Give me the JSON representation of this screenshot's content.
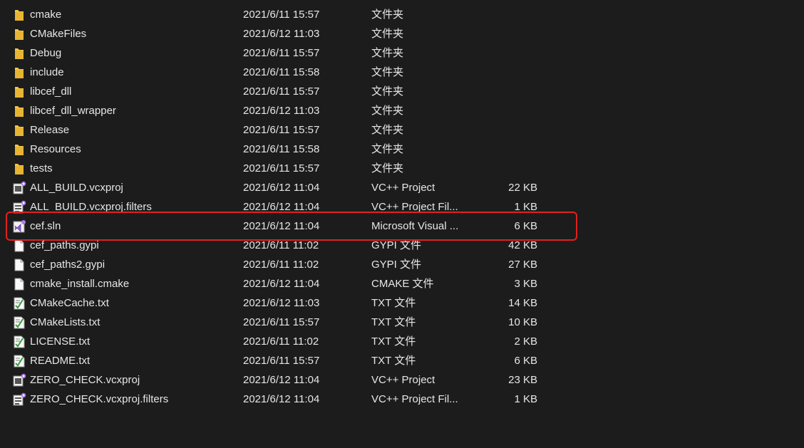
{
  "colors": {
    "background": "#1c1c1c",
    "text": "#e6e6e6",
    "folder": "#f2c545",
    "highlight_border": "#e0221e"
  },
  "files": [
    {
      "name": "cmake",
      "modified": "2021/6/11 15:57",
      "type": "文件夹",
      "size": "",
      "icon": "folder-icon"
    },
    {
      "name": "CMakeFiles",
      "modified": "2021/6/12 11:03",
      "type": "文件夹",
      "size": "",
      "icon": "folder-icon"
    },
    {
      "name": "Debug",
      "modified": "2021/6/11 15:57",
      "type": "文件夹",
      "size": "",
      "icon": "folder-icon"
    },
    {
      "name": "include",
      "modified": "2021/6/11 15:58",
      "type": "文件夹",
      "size": "",
      "icon": "folder-icon"
    },
    {
      "name": "libcef_dll",
      "modified": "2021/6/11 15:57",
      "type": "文件夹",
      "size": "",
      "icon": "folder-icon"
    },
    {
      "name": "libcef_dll_wrapper",
      "modified": "2021/6/12 11:03",
      "type": "文件夹",
      "size": "",
      "icon": "folder-icon"
    },
    {
      "name": "Release",
      "modified": "2021/6/11 15:57",
      "type": "文件夹",
      "size": "",
      "icon": "folder-icon"
    },
    {
      "name": "Resources",
      "modified": "2021/6/11 15:58",
      "type": "文件夹",
      "size": "",
      "icon": "folder-icon"
    },
    {
      "name": "tests",
      "modified": "2021/6/11 15:57",
      "type": "文件夹",
      "size": "",
      "icon": "folder-icon"
    },
    {
      "name": "ALL_BUILD.vcxproj",
      "modified": "2021/6/12 11:04",
      "type": "VC++ Project",
      "size": "22 KB",
      "icon": "vcxproj-icon"
    },
    {
      "name": "ALL_BUILD.vcxproj.filters",
      "modified": "2021/6/12 11:04",
      "type": "VC++ Project Fil...",
      "size": "1 KB",
      "icon": "vcxproj-filters-icon"
    },
    {
      "name": "cef.sln",
      "modified": "2021/6/12 11:04",
      "type": "Microsoft Visual ...",
      "size": "6 KB",
      "icon": "visual-studio-solution-icon"
    },
    {
      "name": "cef_paths.gypi",
      "modified": "2021/6/11 11:02",
      "type": "GYPI 文件",
      "size": "42 KB",
      "icon": "blank-file-icon"
    },
    {
      "name": "cef_paths2.gypi",
      "modified": "2021/6/11 11:02",
      "type": "GYPI 文件",
      "size": "27 KB",
      "icon": "blank-file-icon"
    },
    {
      "name": "cmake_install.cmake",
      "modified": "2021/6/12 11:04",
      "type": "CMAKE 文件",
      "size": "3 KB",
      "icon": "blank-file-icon"
    },
    {
      "name": "CMakeCache.txt",
      "modified": "2021/6/12 11:03",
      "type": "TXT 文件",
      "size": "14 KB",
      "icon": "text-file-icon"
    },
    {
      "name": "CMakeLists.txt",
      "modified": "2021/6/11 15:57",
      "type": "TXT 文件",
      "size": "10 KB",
      "icon": "text-file-icon"
    },
    {
      "name": "LICENSE.txt",
      "modified": "2021/6/11 11:02",
      "type": "TXT 文件",
      "size": "2 KB",
      "icon": "text-file-icon"
    },
    {
      "name": "README.txt",
      "modified": "2021/6/11 15:57",
      "type": "TXT 文件",
      "size": "6 KB",
      "icon": "text-file-icon"
    },
    {
      "name": "ZERO_CHECK.vcxproj",
      "modified": "2021/6/12 11:04",
      "type": "VC++ Project",
      "size": "23 KB",
      "icon": "vcxproj-icon"
    },
    {
      "name": "ZERO_CHECK.vcxproj.filters",
      "modified": "2021/6/12 11:04",
      "type": "VC++ Project Fil...",
      "size": "1 KB",
      "icon": "vcxproj-filters-icon"
    }
  ]
}
